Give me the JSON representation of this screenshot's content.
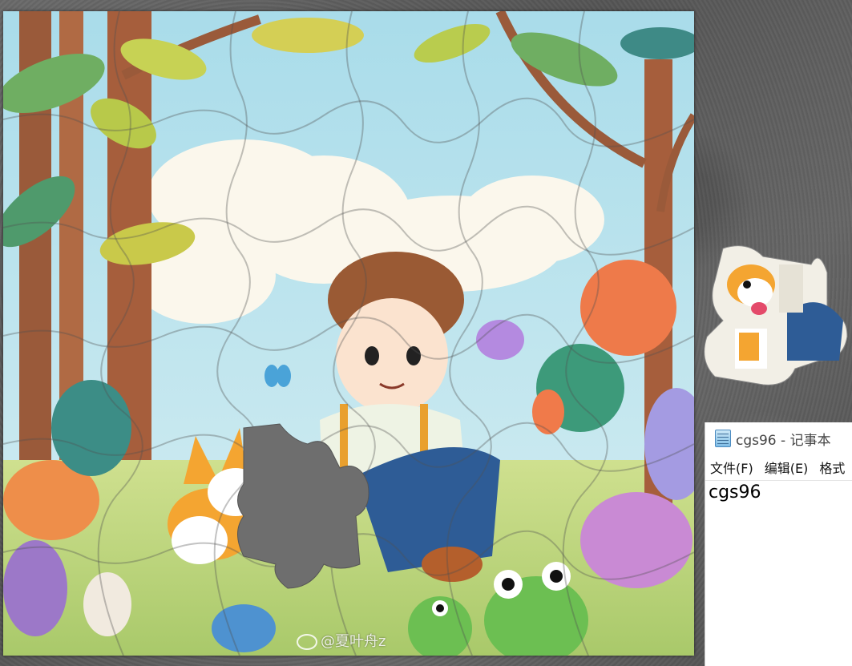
{
  "puzzle": {
    "watermark_text": "@夏叶舟z",
    "missing_slot_color": "#6e6e6e"
  },
  "notepad": {
    "title": "cgs96 - 记事本",
    "menu": [
      "文件(F)",
      "编辑(E)",
      "格式"
    ],
    "content": "cgs96"
  },
  "icons": {
    "notepad": "notepad-icon",
    "weibo": "weibo-logo-icon"
  }
}
